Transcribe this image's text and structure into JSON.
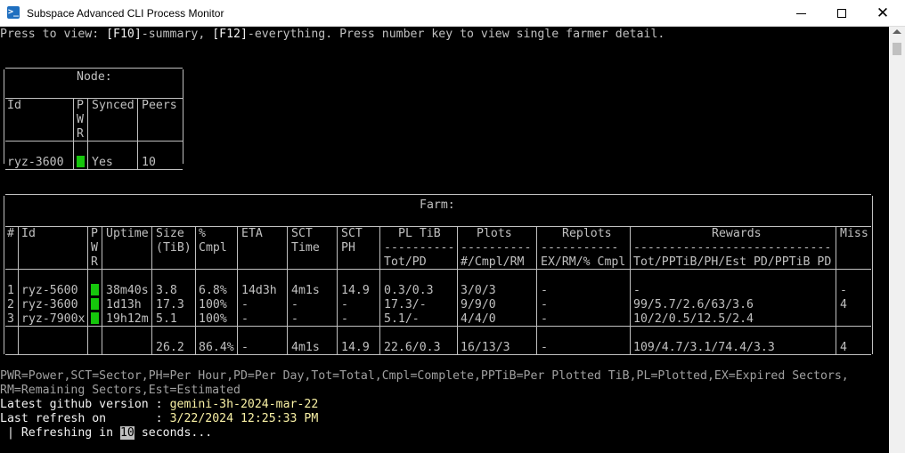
{
  "window": {
    "title": "Subspace Advanced CLI Process Monitor",
    "icon_symbol": ">_",
    "buttons": [
      "minimize",
      "maximize",
      "close"
    ]
  },
  "header_line": {
    "p1": "Press to view: ",
    "k1": "[F10]",
    "p2": "-summary, ",
    "k2": "[F12]",
    "p3": "-everything. Press number key to view single farmer detail."
  },
  "node_table": {
    "title": "Node:",
    "headers": {
      "id": "Id",
      "pwr": [
        "P",
        "W",
        "R"
      ],
      "synced": "Synced",
      "peers": "Peers"
    },
    "row": {
      "id": "ryz-3600",
      "synced": "Yes",
      "peers": "10"
    }
  },
  "farm_table": {
    "title": "Farm:",
    "headers": {
      "num": "#",
      "id": "Id",
      "pwr": [
        "P",
        "W",
        "R"
      ],
      "uptime": "Uptime",
      "size": [
        "Size",
        "(TiB)"
      ],
      "cmpl": [
        "%",
        "Cmpl"
      ],
      "eta": "ETA",
      "sct_time": [
        "SCT",
        "Time"
      ],
      "sct_ph": [
        "SCT",
        "PH"
      ],
      "pl_tib": [
        "PL TiB",
        "----------",
        "Tot/PD"
      ],
      "plots": [
        "Plots",
        "----------",
        "#/Cmpl/RM"
      ],
      "replots": [
        "Replots",
        "-----------",
        "EX/RM/% Cmpl"
      ],
      "rewards": [
        "Rewards",
        "----------------------------",
        "Tot/PPTiB/PH/Est PD/PPTiB PD"
      ],
      "miss": "Miss"
    },
    "rows": [
      {
        "num": "1",
        "id": "ryz-5600",
        "uptime": "38m40s",
        "size": "3.8",
        "cmpl": "6.8%",
        "eta": "14d3h",
        "sct_time": "4m1s",
        "sct_ph": "14.9",
        "pl_tib": "0.3/0.3",
        "plots": "3/0/3",
        "replots": "-",
        "rewards": "-",
        "miss": "-"
      },
      {
        "num": "2",
        "id": "ryz-3600",
        "uptime": "1d13h",
        "size": "17.3",
        "cmpl": "100%",
        "eta": "-",
        "sct_time": "-",
        "sct_ph": "-",
        "pl_tib": "17.3/-",
        "plots": "9/9/0",
        "replots": "-",
        "rewards": "99/5.7/2.6/63/3.6",
        "miss": "4"
      },
      {
        "num": "3",
        "id": "ryz-7900x",
        "uptime": "19h12m",
        "size": "5.1",
        "cmpl": "100%",
        "eta": "-",
        "sct_time": "-",
        "sct_ph": "-",
        "pl_tib": "5.1/-",
        "plots": "4/4/0",
        "replots": "-",
        "rewards": "10/2/0.5/12.5/2.4",
        "miss": ""
      }
    ],
    "totals": {
      "size": "26.2",
      "cmpl": "86.4%",
      "eta": "-",
      "sct_time": "4m1s",
      "sct_ph": "14.9",
      "pl_tib": "22.6/0.3",
      "plots": "16/13/3",
      "replots": "-",
      "rewards": "109/4.7/3.1/74.4/3.3",
      "miss": "4"
    }
  },
  "legend": {
    "line1": "PWR=Power,SCT=Sector,PH=Per Hour,PD=Per Day,Tot=Total,Cmpl=Complete,PPTiB=Per Plotted TiB,PL=Plotted,EX=Expired Sectors,",
    "line2": "RM=Remaining Sectors,Est=Estimated"
  },
  "footer": {
    "github_label": "Latest github version : ",
    "github_value": "gemini-3h-2024-mar-22",
    "refresh_label": "Last refresh on       : ",
    "refresh_value": "3/22/2024 12:25:33 PM",
    "refreshing_pre": " | Refreshing in ",
    "refreshing_num": "10",
    "refreshing_post": " seconds..."
  },
  "colors": {
    "console_bg": "#000000",
    "text": "#c0c0c0",
    "title": "#61d6d6",
    "value": "#f9f1a5",
    "alert": "#e74856",
    "power_ok": "#16c60c"
  }
}
